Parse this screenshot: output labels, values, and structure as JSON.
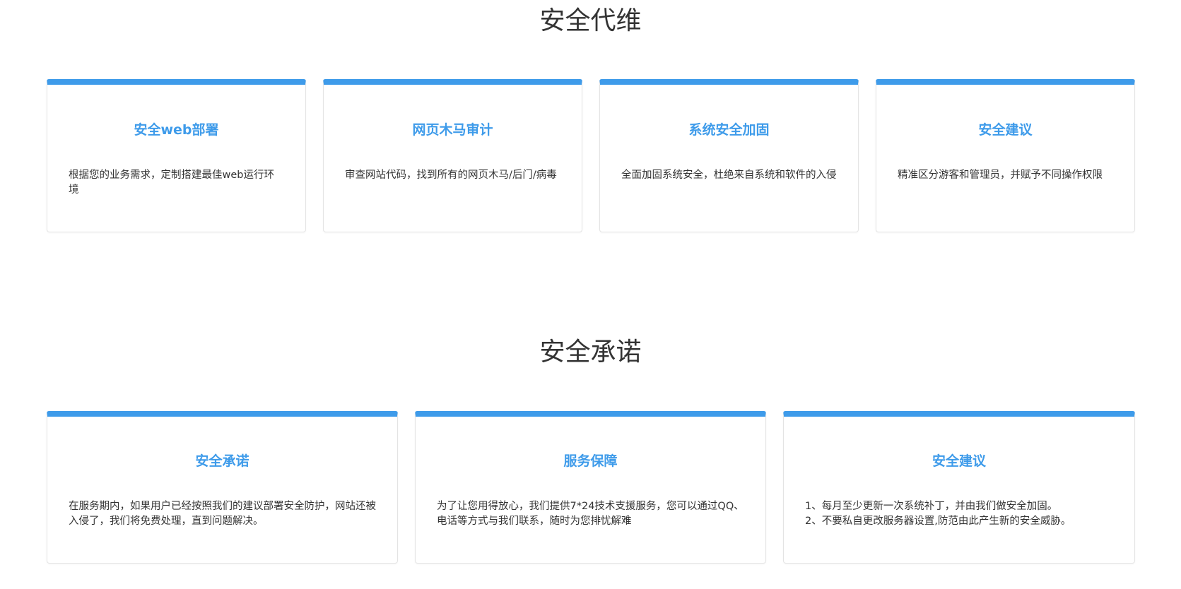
{
  "section1": {
    "title": "安全代维",
    "cards": [
      {
        "title": "安全web部署",
        "desc": "根据您的业务需求，定制搭建最佳web运行环境"
      },
      {
        "title": "网页木马审计",
        "desc": "审查网站代码，找到所有的网页木马/后门/病毒"
      },
      {
        "title": "系统安全加固",
        "desc": "全面加固系统安全，杜绝来自系统和软件的入侵"
      },
      {
        "title": "安全建议",
        "desc": "精准区分游客和管理员，并赋予不同操作权限"
      }
    ]
  },
  "section2": {
    "title": "安全承诺",
    "cards": [
      {
        "title": "安全承诺",
        "desc": "在服务期内，如果用户已经按照我们的建议部署安全防护，网站还被入侵了，我们将免费处理，直到问题解决。"
      },
      {
        "title": "服务保障",
        "desc": "为了让您用得放心，我们提供7*24技术支援服务，您可以通过QQ、电话等方式与我们联系，随时为您排忧解难"
      },
      {
        "title": "安全建议",
        "lines": [
          "1、每月至少更新一次系统补丁，并由我们做安全加固。",
          "2、不要私自更改服务器设置,防范由此产生新的安全威胁。"
        ]
      }
    ]
  },
  "colors": {
    "accent": "#3e9bea",
    "text": "#333333",
    "border": "#e4e4e4"
  }
}
